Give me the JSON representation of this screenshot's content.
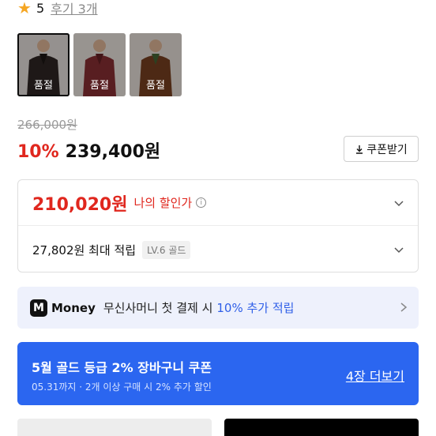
{
  "rating": {
    "star_icon": "★",
    "score": "5",
    "reviews": "후기 3개"
  },
  "thumbnails": [
    {
      "label": "품절",
      "color": "#2a2220"
    },
    {
      "label": "품절",
      "color": "#7b2a2e"
    },
    {
      "label": "품절",
      "color": "#6b3a1e"
    }
  ],
  "price": {
    "original": "266,000원",
    "discount_pct": "10%",
    "sale": "239,400원"
  },
  "coupon": {
    "label": "쿠폰받기"
  },
  "discount": {
    "my_price": "210,020원",
    "my_label": "나의 할인가",
    "points": "27,802원 최대 적립",
    "level": "LV.6 골드"
  },
  "money": {
    "logo": "M",
    "brand": "Money",
    "desc": "무신사머니 첫 결제 시",
    "highlight": "10% 추가 적립"
  },
  "gold": {
    "title": "5월 골드 등급 2% 장바구니 쿠폰",
    "sub": "05.31까지 · 2개 이상 구매 시 2% 추가 할인",
    "link": "4장 더보기"
  },
  "colors": {
    "accent_red": "#e0271e",
    "accent_blue": "#2b66f0",
    "star": "#f5a623"
  }
}
